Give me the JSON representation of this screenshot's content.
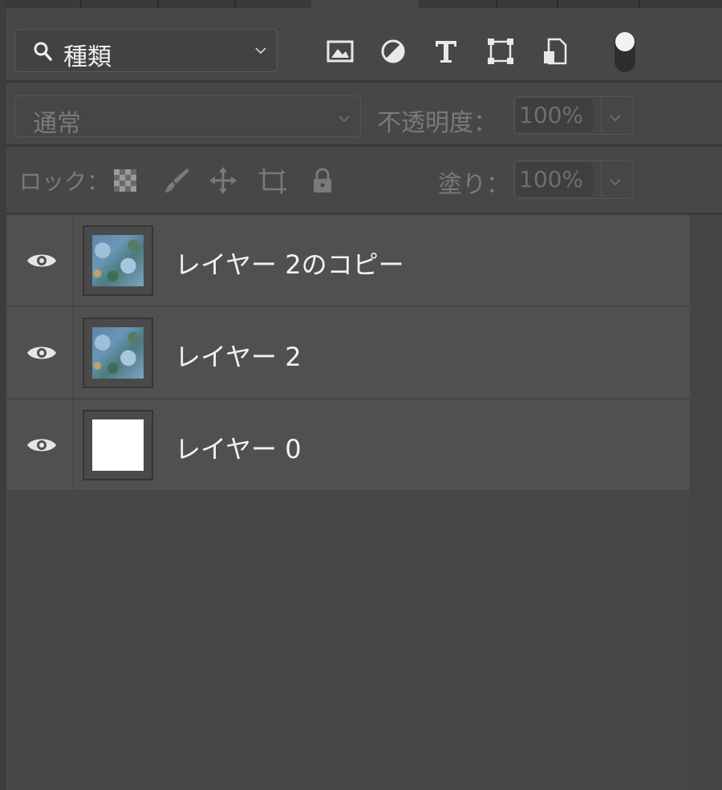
{
  "filter": {
    "kind_label": "種類",
    "icons": [
      "image-filter-icon",
      "adjustment-filter-icon",
      "type-filter-icon",
      "shape-filter-icon",
      "smart-object-filter-icon"
    ],
    "toggle": "on"
  },
  "blend": {
    "mode": "通常",
    "opacity_label": "不透明度：",
    "opacity_value": "100%"
  },
  "lock": {
    "label": "ロック：",
    "icons": [
      "lock-transparent-pixels-icon",
      "lock-image-pixels-icon",
      "lock-position-icon",
      "lock-artboard-icon",
      "lock-all-icon"
    ],
    "fill_label": "塗り：",
    "fill_value": "100%"
  },
  "layers": [
    {
      "name": "レイヤー 2のコピー",
      "visible": true,
      "thumbnail": "painting"
    },
    {
      "name": "レイヤー 2",
      "visible": true,
      "thumbnail": "painting"
    },
    {
      "name": "レイヤー 0",
      "visible": true,
      "thumbnail": "white"
    }
  ],
  "colors": {
    "panel": "#474747",
    "layer_row": "#505050",
    "text": "#f2f2f2",
    "dim_text": "#7a7a7a"
  }
}
